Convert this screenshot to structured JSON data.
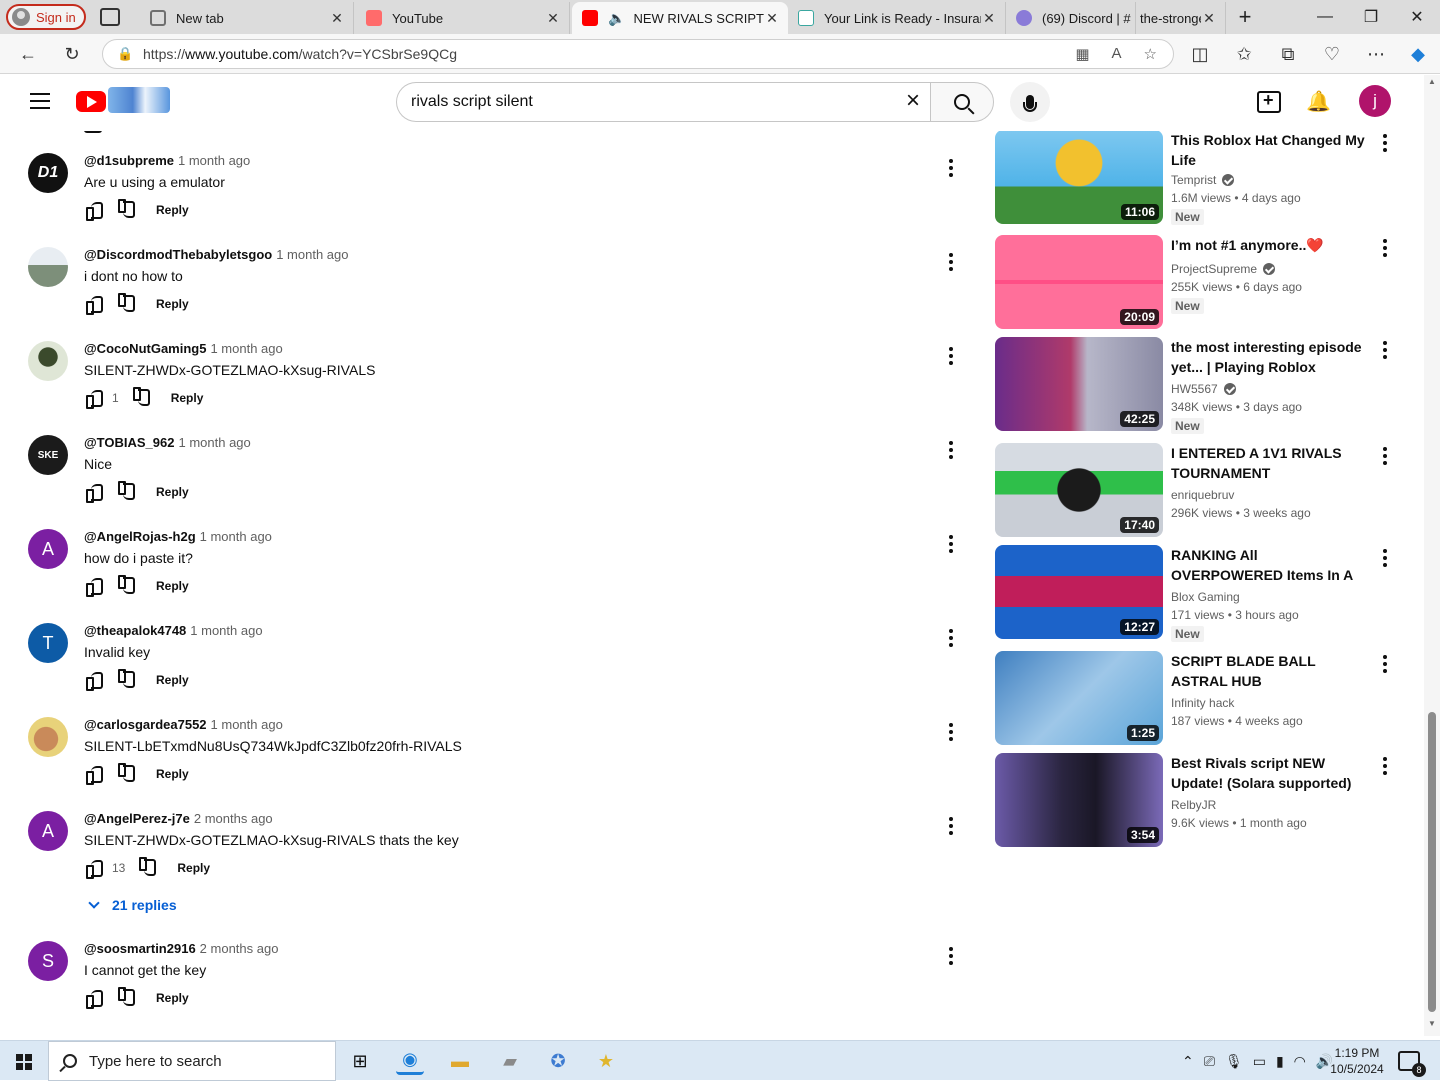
{
  "browser": {
    "signin_label": "Sign in",
    "tabs": [
      {
        "title": "New tab",
        "favicon_color": "#6f6f6f"
      },
      {
        "title": "YouTube",
        "favicon_color": "#ff5a5a"
      },
      {
        "title": "NEW RIVALS SCRIPT SILENT",
        "favicon_color": "#ff0000"
      },
      {
        "title": "Your Link is Ready - Insurance",
        "favicon_color": "#3aa7a0"
      },
      {
        "title": "(69) Discord | #",
        "favicon_color": "#8a7bd8"
      },
      {
        "title": "the-strongest",
        "favicon_color": "#d9d9d9"
      }
    ],
    "url_prefix": "https://",
    "url_host": "www.youtube.com",
    "url_path": "/watch?v=YCSbrSe9QCg"
  },
  "youtube": {
    "search_value": "rivals script silent",
    "user_initial": "j",
    "brand_color": "#ff0000"
  },
  "comments": [
    {
      "user": "@d1subpreme",
      "time": "1 month ago",
      "text": "Are u using a emulator",
      "likes": "",
      "avatar_text": "D1",
      "avatar_color": "#111111"
    },
    {
      "user": "@DiscordmodThebabyletsgoo",
      "time": "1 month ago",
      "text": "i dont no how to",
      "likes": "",
      "avatar_text": "",
      "avatar_color": "#7d8f7a"
    },
    {
      "user": "@CocoNutGaming5",
      "time": "1 month ago",
      "text": "SILENT-ZHWDx-GOTEZLMAO-kXsug-RIVALS",
      "likes": "1",
      "avatar_text": "",
      "avatar_color": "#5b7a4e"
    },
    {
      "user": "@TOBIAS_962",
      "time": "1 month ago",
      "text": "Nice",
      "likes": "",
      "avatar_text": "SKE",
      "avatar_color": "#1b1b1b"
    },
    {
      "user": "@AngelRojas-h2g",
      "time": "1 month ago",
      "text": "how do i paste it?",
      "likes": "",
      "avatar_text": "A",
      "avatar_color": "#7b1fa2"
    },
    {
      "user": "@theapalok4748",
      "time": "1 month ago",
      "text": "Invalid key",
      "likes": "",
      "avatar_text": "T",
      "avatar_color": "#0d5ba6"
    },
    {
      "user": "@carlosgardea7552",
      "time": "1 month ago",
      "text": "SILENT-LbETxmdNu8UsQ734WkJpdfC3Zlb0fz20frh-RIVALS",
      "likes": "",
      "avatar_text": "",
      "avatar_color": "#c49a3b"
    },
    {
      "user": "@AngelPerez-j7e",
      "time": "2 months ago",
      "text": "SILENT-ZHWDx-GOTEZLMAO-kXsug-RIVALS thats the key",
      "likes": "13",
      "avatar_text": "A",
      "avatar_color": "#7b1fa2",
      "replies": "21 replies"
    },
    {
      "user": "@soosmartin2916",
      "time": "2 months ago",
      "text": "I cannot get the key",
      "likes": "",
      "avatar_text": "S",
      "avatar_color": "#7b1fa2"
    }
  ],
  "reply_label": "Reply",
  "recommendations": [
    {
      "title": "This Roblox Hat Changed My Life",
      "channel": "Temprist",
      "verified": true,
      "views": "1.6M views",
      "age": "4 days ago",
      "new": "New",
      "duration": "11:06",
      "thumb_colors": [
        "#4fb3e8",
        "#f2c12e"
      ]
    },
    {
      "title": "I’m not #1 anymore..❤️",
      "channel": "ProjectSupreme",
      "verified": true,
      "views": "255K views",
      "age": "6 days ago",
      "new": "New",
      "duration": "20:09",
      "thumb_colors": [
        "#ff5f8f",
        "#2c2c2c"
      ]
    },
    {
      "title": "the most interesting episode yet... | Playing Roblox Anime...",
      "channel": "HW5567",
      "verified": true,
      "views": "348K views",
      "age": "3 days ago",
      "new": "New",
      "duration": "42:25",
      "thumb_colors": [
        "#6a2c8a",
        "#b7b7c9"
      ]
    },
    {
      "title": "I ENTERED A 1V1 RIVALS TOURNAMENT",
      "channel": "enriquebruv",
      "verified": false,
      "views": "296K views",
      "age": "3 weeks ago",
      "new": "",
      "duration": "17:40",
      "thumb_colors": [
        "#2fbf4a",
        "#d6dbe2"
      ]
    },
    {
      "title": "RANKING All OVERPOWERED Items In A TIER LIST - Blox...",
      "channel": "Blox Gaming",
      "verified": false,
      "views": "171 views",
      "age": "3 hours ago",
      "new": "New",
      "duration": "12:27",
      "thumb_colors": [
        "#1c63c9",
        "#c01e5a"
      ]
    },
    {
      "title": "SCRIPT BLADE BALL ASTRAL HUB",
      "channel": "Infinity hack",
      "verified": false,
      "views": "187 views",
      "age": "4 weeks ago",
      "new": "",
      "duration": "1:25",
      "thumb_colors": [
        "#5aa4d8",
        "#9ec7e8"
      ]
    },
    {
      "title": "Best Rivals script NEW Update! (Solara supported) PASTEBIN",
      "channel": "RelbyJR",
      "verified": false,
      "views": "9.6K views",
      "age": "1 month ago",
      "new": "",
      "duration": "3:54",
      "thumb_colors": [
        "#6b5aa8",
        "#2a2540"
      ]
    }
  ],
  "taskbar": {
    "search_placeholder": "Type here to search",
    "time": "1:19 PM",
    "date": "10/5/2024",
    "notification_count": "8"
  }
}
